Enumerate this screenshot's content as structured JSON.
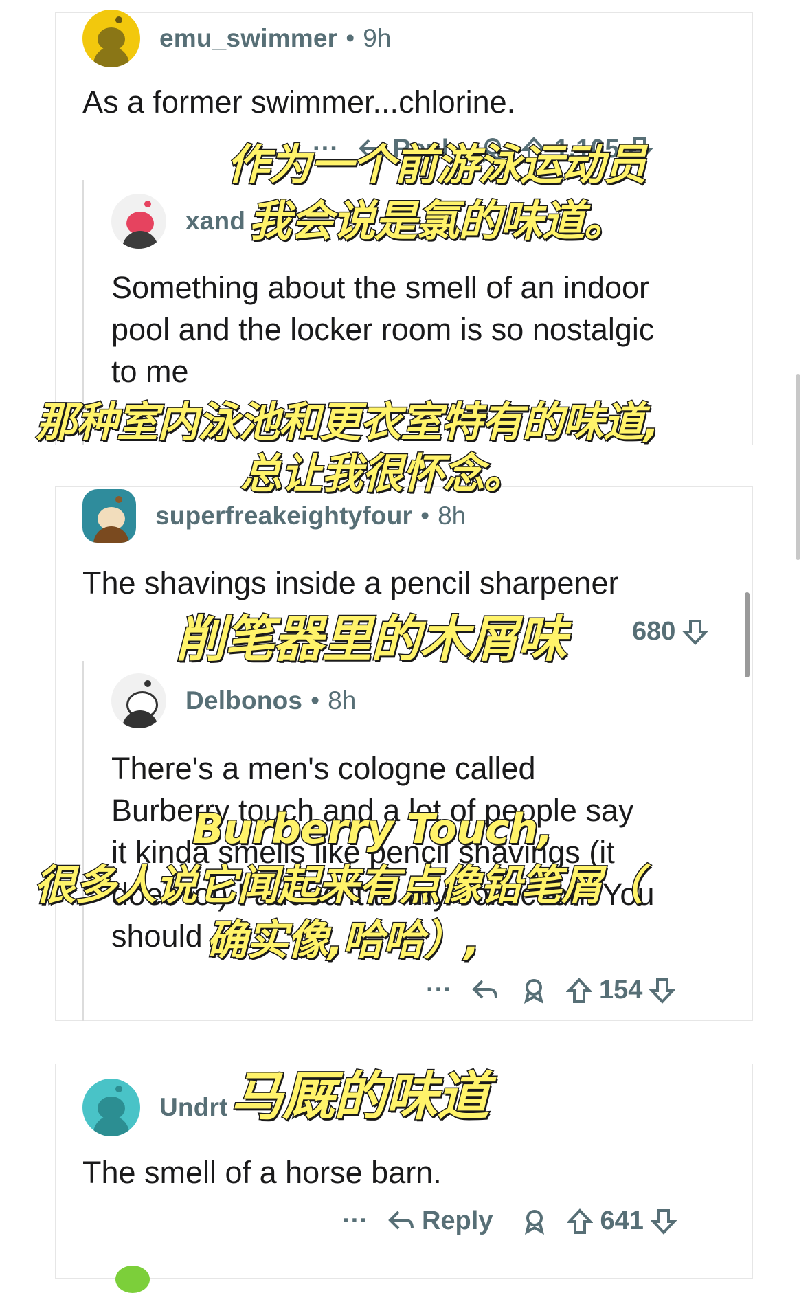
{
  "comments": [
    {
      "username": "emu_swimmer",
      "age": "9h",
      "text": "As a former swimmer...chlorine.",
      "actions": {
        "reply": "Reply",
        "votes": "1,105"
      },
      "reply": {
        "username": "xand",
        "text_lines": [
          "Something about the smell of an indoor",
          "pool and the locker room is so nostalgic",
          "to me"
        ]
      }
    },
    {
      "username": "superfreakeightyfour",
      "age": "8h",
      "text": "The shavings inside a pencil sharpener",
      "actions": {
        "votes": "680"
      },
      "reply": {
        "username": "Delbonos",
        "age": "8h",
        "text_lines": [
          "There's a men's cologne called",
          "Burberry touch and a lot of people say",
          "it kinda smells like pencil shavings (it",
          "does lol) I added it to my collection. You",
          "should"
        ],
        "actions": {
          "votes": "154"
        }
      }
    },
    {
      "username": "Undrt",
      "text": "The smell of a horse barn.",
      "actions": {
        "more": "···",
        "reply": "Reply",
        "votes": "641"
      }
    }
  ],
  "overlay_captions": {
    "c1_line1": "作为一个前游泳运动员",
    "c1_line2": "我会说是氯的味道。",
    "c2_line1": "那种室内泳池和更衣室特有的味道,",
    "c2_line2": "总让我很怀念。",
    "c3_line1": "削笔器里的木屑味",
    "c4_line1": "Burberry Touch,",
    "c4_line2": "很多人说它闻起来有点像铅笔屑（",
    "c4_line3": "确实像,哈哈）,",
    "c5_line1": "马厩的味道"
  },
  "colors": {
    "overlay_fill": "#fff36a",
    "meta_text": "#576f76"
  }
}
